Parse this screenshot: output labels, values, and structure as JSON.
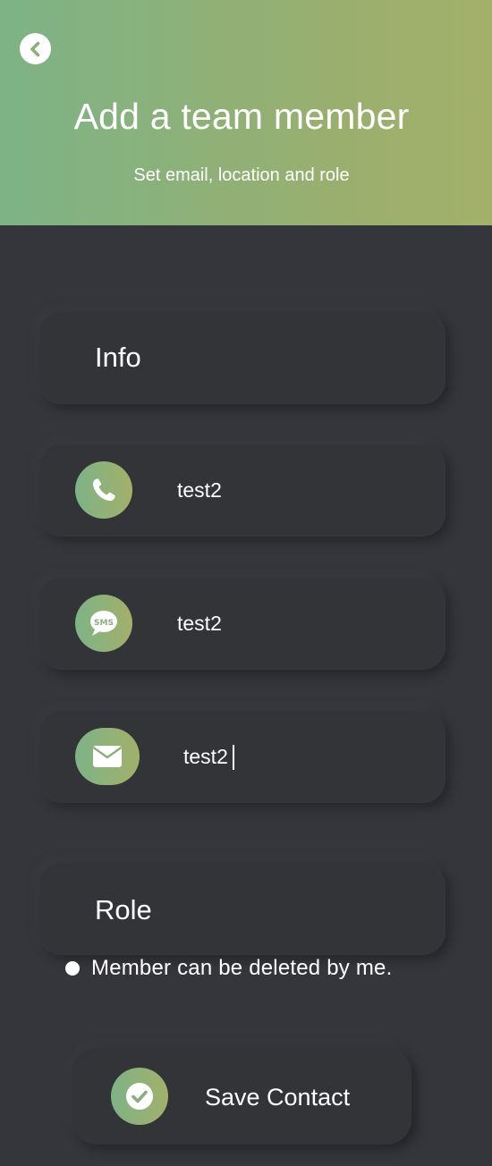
{
  "header": {
    "title": "Add a team member",
    "subtitle": "Set email, location and role",
    "back_icon": "chevron-left-icon",
    "gradient_colors": [
      "#7db387",
      "#a3b06a"
    ]
  },
  "info_card": {
    "title": "Info"
  },
  "fields": {
    "phone": {
      "icon": "phone-icon",
      "value": "test2"
    },
    "sms": {
      "icon": "sms-icon",
      "icon_text": "SMS",
      "value": "test2"
    },
    "email": {
      "icon": "envelope-icon",
      "value": "test2"
    }
  },
  "role_card": {
    "title": "Role"
  },
  "role_option": {
    "label": "Member can be deleted by me."
  },
  "save_button": {
    "label": "Save Contact",
    "icon": "check-circle-icon"
  },
  "colors": {
    "background": "#35363b",
    "card": "#333438",
    "text": "#ffffff"
  }
}
